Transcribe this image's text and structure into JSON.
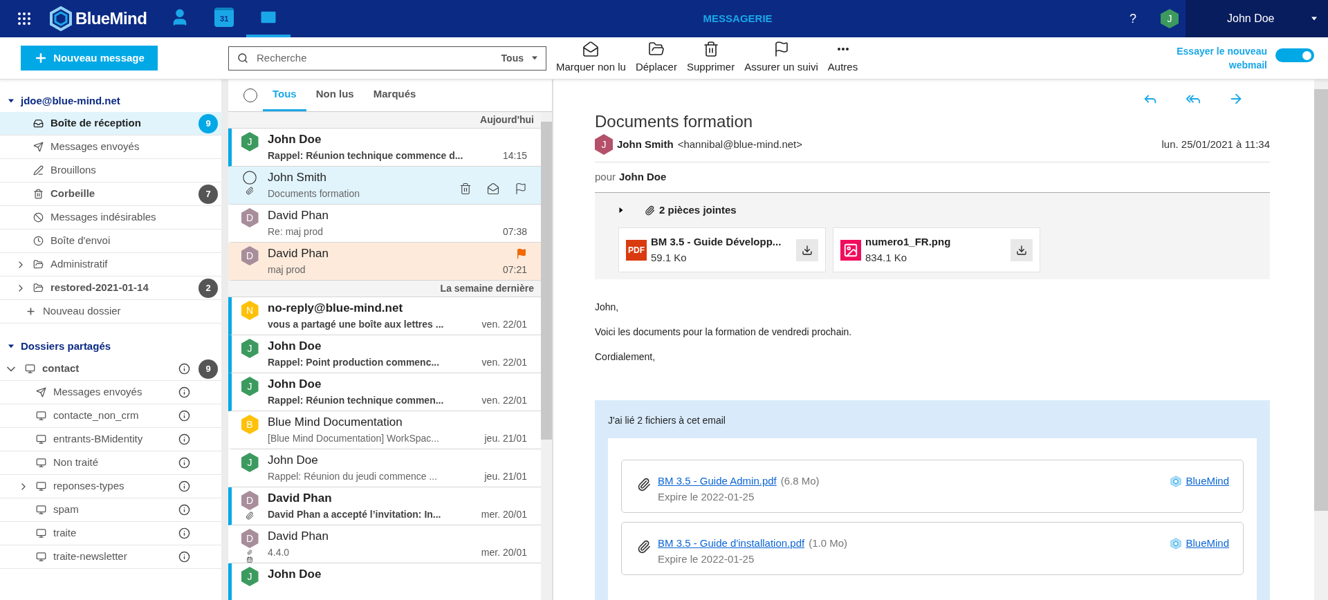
{
  "topbar": {
    "logo": "BlueMind",
    "apps": [
      {
        "kind": "contacts",
        "selected": false
      },
      {
        "kind": "calendar",
        "day": "31",
        "selected": false
      },
      {
        "kind": "mail",
        "selected": true
      }
    ],
    "section": "MESSAGERIE",
    "help": "?",
    "user": {
      "initial": "J",
      "color": "#3c9a5f",
      "name": "John Doe"
    }
  },
  "toolbar": {
    "new_message": "Nouveau message",
    "search": {
      "placeholder": "Recherche",
      "scope": "Tous"
    },
    "actions": [
      {
        "kind": "mark_unread",
        "label": "Marquer non lu"
      },
      {
        "kind": "move",
        "label": "Déplacer"
      },
      {
        "kind": "delete",
        "label": "Supprimer"
      },
      {
        "kind": "flag",
        "label": "Assurer un suivi"
      },
      {
        "kind": "more",
        "label": "Autres"
      }
    ],
    "try_new": {
      "line_1": "Essayer le nouveau",
      "line_2": "webmail",
      "on": true
    }
  },
  "sidebar": {
    "account": "jdoe@blue-mind.net",
    "folders": [
      {
        "kind": "inbox",
        "label": "Boîte de réception",
        "bold": true,
        "selected": true,
        "count": "9"
      },
      {
        "kind": "sent",
        "label": "Messages envoyés",
        "bold": false,
        "selected": false
      },
      {
        "kind": "drafts",
        "label": "Brouillons",
        "bold": false,
        "selected": false
      },
      {
        "kind": "trash",
        "label": "Corbeille",
        "bold": true,
        "selected": false,
        "count": "7"
      },
      {
        "kind": "spam",
        "label": "Messages indésirables",
        "bold": false,
        "selected": false
      },
      {
        "kind": "outbox",
        "label": "Boîte d'envoi",
        "bold": false,
        "selected": false
      },
      {
        "kind": "folder",
        "label": "Administratif",
        "bold": false,
        "selected": false,
        "expandable": true
      },
      {
        "kind": "folder",
        "label": "restored-2021-01-14",
        "bold": true,
        "selected": false,
        "expandable": true,
        "count": "2"
      }
    ],
    "new_folder": "Nouveau dossier",
    "shared_title": "Dossiers partagés",
    "shared": [
      {
        "kind": "shared",
        "label": "contact",
        "bold": true,
        "expanded": true,
        "count": "9",
        "children": [
          {
            "kind": "sent",
            "label": "Messages envoyés"
          },
          {
            "kind": "shared",
            "label": "contacte_non_crm"
          },
          {
            "kind": "shared",
            "label": "entrants-BMidentity"
          },
          {
            "kind": "shared",
            "label": "Non traité"
          },
          {
            "kind": "shared",
            "label": "reponses-types",
            "expandable": true
          },
          {
            "kind": "shared",
            "label": "spam"
          },
          {
            "kind": "shared",
            "label": "traite"
          },
          {
            "kind": "shared",
            "label": "traite-newsletter"
          }
        ]
      }
    ]
  },
  "message_list": {
    "all_selected": false,
    "tabs": [
      {
        "label": "Tous",
        "selected": true
      },
      {
        "label": "Non lus",
        "selected": false
      },
      {
        "label": "Marqués",
        "selected": false
      }
    ],
    "groups": [
      {
        "label": "Aujourd'hui",
        "messages": [
          {
            "initial": "J",
            "color": "#3c9a5f",
            "sender": "John Doe",
            "subject": "Rappel: Réunion technique commence d...",
            "time": "14:15",
            "unread": true,
            "selected": false,
            "flagged": false
          },
          {
            "sender": "John Smith",
            "subject": "Documents formation",
            "unread": false,
            "selected": true,
            "flagged": false,
            "attachment": true
          },
          {
            "initial": "D",
            "color": "#a88d9a",
            "sender": "David Phan",
            "subject": "Re: maj prod",
            "time": "07:38",
            "unread": false,
            "selected": false,
            "flagged": false
          },
          {
            "initial": "D",
            "color": "#a88d9a",
            "sender": "David Phan",
            "subject": "maj prod",
            "time": "07:21",
            "unread": false,
            "selected": false,
            "flagged": true
          }
        ]
      },
      {
        "label": "La semaine dernière",
        "messages": [
          {
            "initial": "N",
            "color": "#ffc107",
            "sender": "no-reply@blue-mind.net",
            "subject": "vous a partagé une boîte aux lettres ...",
            "time": "ven. 22/01",
            "unread": true,
            "selected": false,
            "flagged": false
          },
          {
            "initial": "J",
            "color": "#3c9a5f",
            "sender": "John Doe",
            "subject": "Rappel: Point production commenc...",
            "time": "ven. 22/01",
            "unread": true,
            "selected": false,
            "flagged": false
          },
          {
            "initial": "J",
            "color": "#3c9a5f",
            "sender": "John Doe",
            "subject": "Rappel: Réunion technique commen...",
            "time": "ven. 22/01",
            "unread": true,
            "selected": false,
            "flagged": false
          },
          {
            "initial": "B",
            "color": "#ffc107",
            "sender": "Blue Mind Documentation",
            "subject": "[Blue Mind Documentation] WorkSpac...",
            "time": "jeu. 21/01",
            "unread": false,
            "selected": false,
            "flagged": false
          },
          {
            "initial": "J",
            "color": "#3c9a5f",
            "sender": "John Doe",
            "subject": "Rappel: Réunion du jeudi commence ...",
            "time": "jeu. 21/01",
            "unread": false,
            "selected": false,
            "flagged": false
          },
          {
            "initial": "D",
            "color": "#a88d9a",
            "sender": "David Phan",
            "subject": "David Phan a accepté l’invitation: In...",
            "time": "mer. 20/01",
            "unread": true,
            "selected": false,
            "flagged": false,
            "attachment": true
          },
          {
            "initial": "D",
            "color": "#a88d9a",
            "sender": "David Phan",
            "subject": "4.4.0",
            "time": "mer. 20/01",
            "unread": false,
            "selected": false,
            "flagged": false,
            "attachment": true,
            "invitation": true
          },
          {
            "initial": "J",
            "color": "#3c9a5f",
            "sender": "John Doe",
            "unread": true,
            "selected": false,
            "flagged": false
          }
        ]
      }
    ]
  },
  "reader": {
    "subject": "Documents formation",
    "sender": {
      "initial": "J",
      "color": "#b5506b",
      "name": "John Smith",
      "email": "<hannibal@blue-mind.net>"
    },
    "date": "lun. 25/01/2021 à 11:34",
    "to_label": "pour",
    "to": "John Doe",
    "attachments": {
      "title": "2 pièces jointes",
      "files": [
        {
          "kind": "pdf",
          "badge": "PDF",
          "name": "BM 3.5 - Guide Développ...",
          "size": "59.1 Ko"
        },
        {
          "kind": "image",
          "name": "numero1_FR.png",
          "size": "834.1 Ko"
        }
      ]
    },
    "body": [
      "John,",
      "Voici les documents pour la formation de vendredi prochain.",
      "Cordialement,"
    ],
    "linked": {
      "intro": "J'ai lié 2 fichiers à cet email",
      "files": [
        {
          "name": "BM 3.5 - Guide Admin.pdf",
          "size": "(6.8 Mo)",
          "expiry": "Expire le 2022-01-25",
          "provider": "BlueMind"
        },
        {
          "name": "BM 3.5 - Guide d'installation.pdf",
          "size": "(1.0 Mo)",
          "expiry": "Expire le 2022-01-25",
          "provider": "BlueMind"
        }
      ]
    }
  }
}
